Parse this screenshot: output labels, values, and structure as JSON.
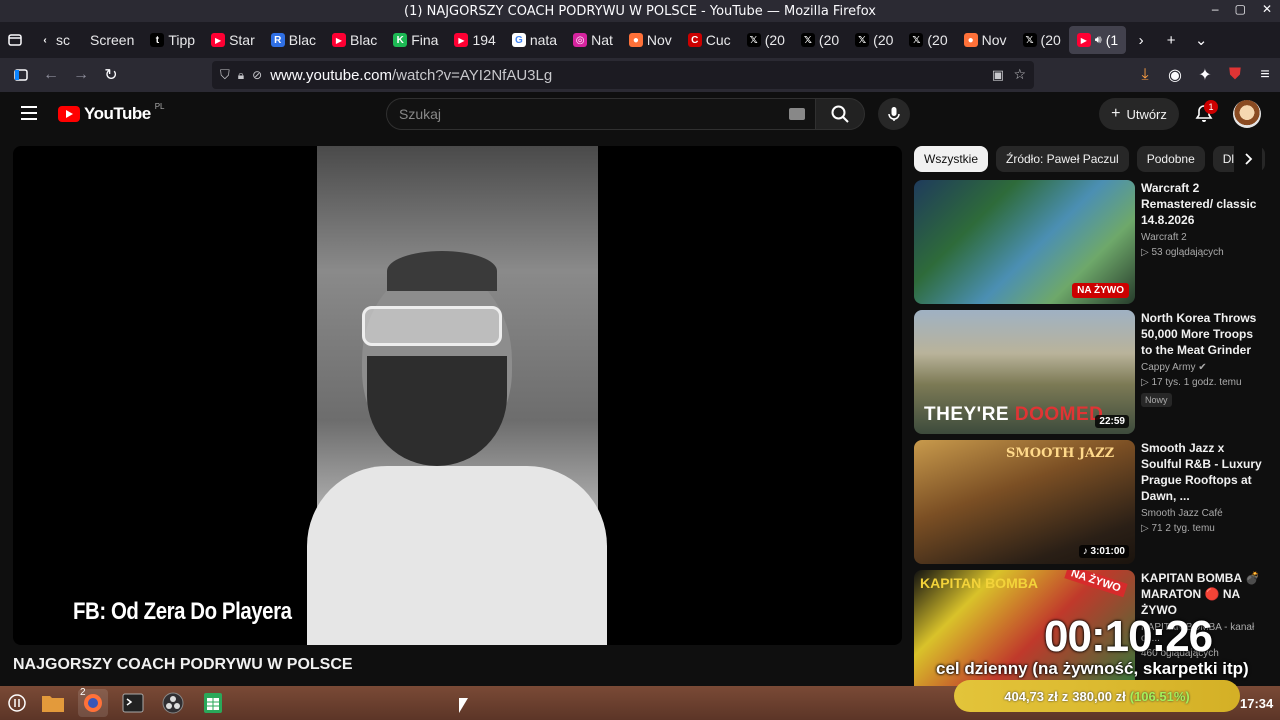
{
  "window": {
    "title": "(1) NAJGORSZY COACH PODRYWU W POLSCE - YouTube — Mozilla Firefox",
    "controls": [
      "–",
      "▢",
      "✕"
    ]
  },
  "tabs": [
    {
      "label": "sc",
      "fav": "chevron",
      "color": "#00000000"
    },
    {
      "label": "Screen",
      "fav": "none",
      "color": "#00000000"
    },
    {
      "label": "Tipp",
      "fav": "tip",
      "color": "#000000"
    },
    {
      "label": "Star",
      "fav": "yt",
      "color": "#ff0033"
    },
    {
      "label": "Blac",
      "fav": "R",
      "color": "#2f6fe4"
    },
    {
      "label": "Blac",
      "fav": "yt",
      "color": "#ff0033"
    },
    {
      "label": "Fina",
      "fav": "K",
      "color": "#1db954"
    },
    {
      "label": "194",
      "fav": "yt",
      "color": "#ff0033"
    },
    {
      "label": "nata",
      "fav": "G",
      "color": "#ffffff"
    },
    {
      "label": "Nat",
      "fav": "ig",
      "color": "#d6249f"
    },
    {
      "label": "Nov",
      "fav": "ff",
      "color": "#ff7139"
    },
    {
      "label": "Cuc",
      "fav": "CNN",
      "color": "#cc0000"
    },
    {
      "label": "(20",
      "fav": "X",
      "color": "#000000"
    },
    {
      "label": "(20",
      "fav": "X",
      "color": "#000000"
    },
    {
      "label": "(20",
      "fav": "X",
      "color": "#000000"
    },
    {
      "label": "(20",
      "fav": "X",
      "color": "#000000"
    },
    {
      "label": "Nov",
      "fav": "ff",
      "color": "#ff7139"
    },
    {
      "label": "(20",
      "fav": "X",
      "color": "#000000"
    },
    {
      "label": "(1",
      "fav": "yt",
      "color": "#ff0033",
      "active": true
    }
  ],
  "url": {
    "host": "www.youtube.com",
    "path": "/watch?v=AYI2NfAU3Lg"
  },
  "youtube": {
    "logo": "YouTube",
    "country": "PL",
    "search_placeholder": "Szukaj",
    "create_label": "Utwórz",
    "notif_count": "1"
  },
  "player": {
    "overlay_text": "FB: Od Zera Do Playera",
    "title": "NAJGORSZY COACH PODRYWU W POLSCE"
  },
  "chips": [
    "Wszystkie",
    "Źródło: Paweł Paczul",
    "Podobne",
    "Dla Ci"
  ],
  "recommendations": [
    {
      "title": "Warcraft 2 Remastered/ classic 14.8.2026",
      "channel": "Warcraft 2",
      "stats": "▷ 53 oglądających",
      "badge": "NA ŻYWO",
      "verified": false
    },
    {
      "title": "North Korea Throws 50,000 More Troops to the Meat Grinder",
      "channel": "Cappy Army",
      "stats": "▷ 17 tys.   1 godz. temu",
      "tag": "Nowy",
      "duration": "22:59",
      "thumb_text_a": "THEY'RE ",
      "thumb_text_b": "DOOMED",
      "verified": true
    },
    {
      "title": "Smooth Jazz x Soulful R&B - Luxury Prague Rooftops at Dawn, ...",
      "channel": "Smooth Jazz Café",
      "stats": "▷ 71   2 tyg. temu",
      "duration": "♪ 3:01:00",
      "thumb_text": "SMOOTH JAZZ",
      "verified": false
    },
    {
      "title": "KAPITAN BOMBA 💣 MARATON 🔴 NA ŻYWO",
      "channel": "KAPITAN BOMBA - kanał ofi...",
      "stats": "460 oglądających",
      "thumb_text": "KAPITAN BOMBA",
      "thumb_badge": "NA ŻYWO",
      "verified": false
    }
  ],
  "stream_overlay": {
    "timer": "00:10:26",
    "goal_label": "cel dzienny (na żywność, skarpetki itp)",
    "goal_current": "404,73 zł",
    "goal_sep": "z",
    "goal_target": "380,00 zł",
    "goal_pct": "(106.51%)",
    "goal_fraction": 1.0651
  },
  "taskbar": {
    "clock": "17:34",
    "firefox_badge": "2"
  },
  "colors": {
    "yt_red": "#ff0000",
    "firefox_dark": "#1c1b22",
    "taskbar": "#6b3e2e",
    "goal_bar": "#d9b92e"
  }
}
